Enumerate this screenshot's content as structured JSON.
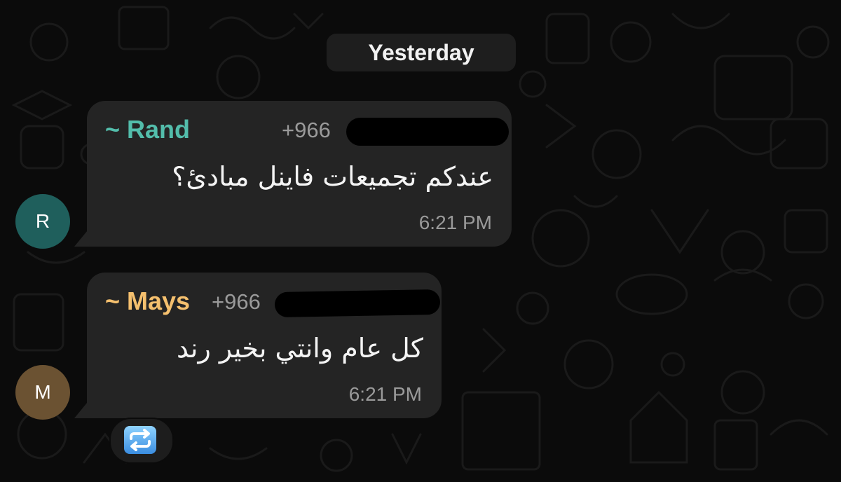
{
  "date_separator": "Yesterday",
  "messages": [
    {
      "avatar_letter": "R",
      "sender": "~ Rand",
      "phone": "+966",
      "text": "عندكم تجميعات فاينل مبادئ؟",
      "time": "6:21 PM",
      "sender_color": "#53bdab",
      "avatar_color": "#1f5f5c"
    },
    {
      "avatar_letter": "M",
      "sender": "~ Mays",
      "phone": "+966",
      "text": "كل عام وانتي بخير رند",
      "time": "6:21 PM",
      "sender_color": "#f5c06e",
      "avatar_color": "#6b5232",
      "reaction": "repeat-button-emoji"
    }
  ],
  "colors": {
    "background": "#0b0b0b",
    "bubble": "#242424",
    "muted_text": "#9a9a9a"
  }
}
